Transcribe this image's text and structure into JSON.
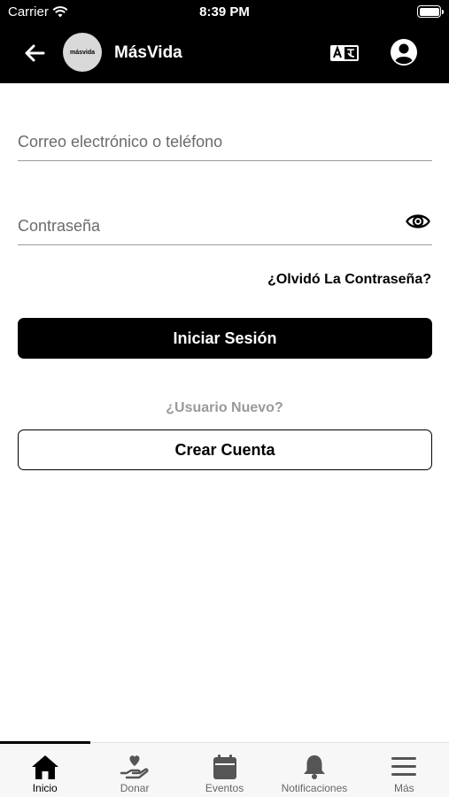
{
  "status_bar": {
    "carrier": "Carrier",
    "time": "8:39 PM"
  },
  "header": {
    "logo_text": "másvida",
    "title": "MásVida",
    "icons": [
      "back-arrow-icon",
      "translate-icon",
      "account-icon"
    ]
  },
  "form": {
    "email_placeholder": "Correo electrónico o teléfono",
    "email_value": "",
    "password_placeholder": "Contraseña",
    "password_value": "",
    "forgot_label": "¿Olvidó La Contraseña?",
    "login_label": "Iniciar Sesión",
    "new_user_label": "¿Usuario Nuevo?",
    "create_account_label": "Crear Cuenta"
  },
  "tabbar": {
    "items": [
      {
        "label": "Inicio",
        "icon": "home-icon",
        "active": true
      },
      {
        "label": "Donar",
        "icon": "donate-icon",
        "active": false
      },
      {
        "label": "Eventos",
        "icon": "calendar-icon",
        "active": false
      },
      {
        "label": "Notificaciones",
        "icon": "bell-icon",
        "active": false
      },
      {
        "label": "Más",
        "icon": "menu-icon",
        "active": false
      }
    ]
  },
  "colors": {
    "header_bg": "#000000",
    "primary_button": "#000000",
    "muted_text": "#9a9a9a",
    "tabbar_bg": "#f7f7f7"
  }
}
